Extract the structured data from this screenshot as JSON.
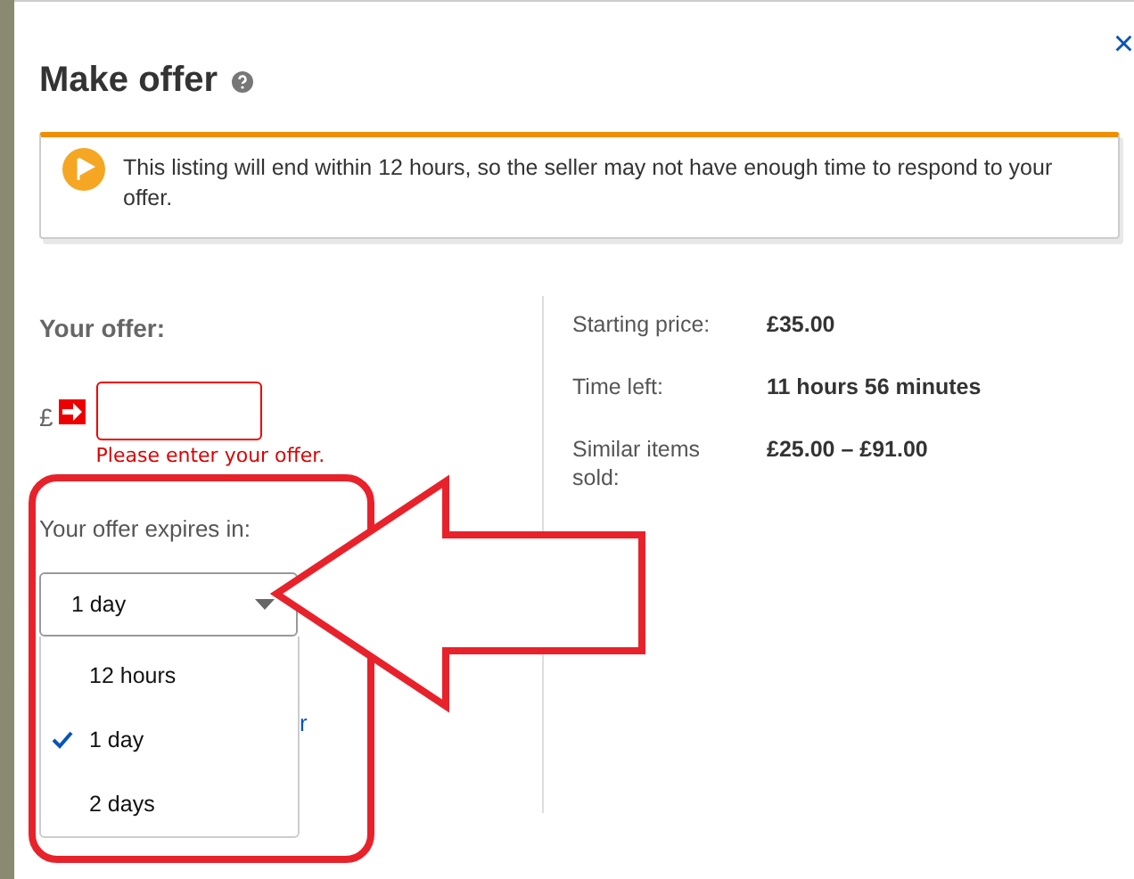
{
  "dialog": {
    "title": "Make offer",
    "close": "×"
  },
  "notice": {
    "text": "This listing will end within 12 hours, so the seller may not have enough time to respond to your offer."
  },
  "offer": {
    "heading": "Your offer:",
    "currency": "£",
    "error": "Please enter your offer.",
    "expires_label": "Your offer expires in:",
    "expires_value": "1 day",
    "hidden_link_fragment": "r",
    "options": [
      {
        "label": "12 hours",
        "selected": false
      },
      {
        "label": "1 day",
        "selected": true
      },
      {
        "label": "2 days",
        "selected": false
      }
    ]
  },
  "details": [
    {
      "label": "Starting price:",
      "value": "£35.00"
    },
    {
      "label": "Time left:",
      "value": "11 hours 56 minutes"
    },
    {
      "label": "Similar items sold:",
      "value": "£25.00 – £91.00"
    }
  ]
}
